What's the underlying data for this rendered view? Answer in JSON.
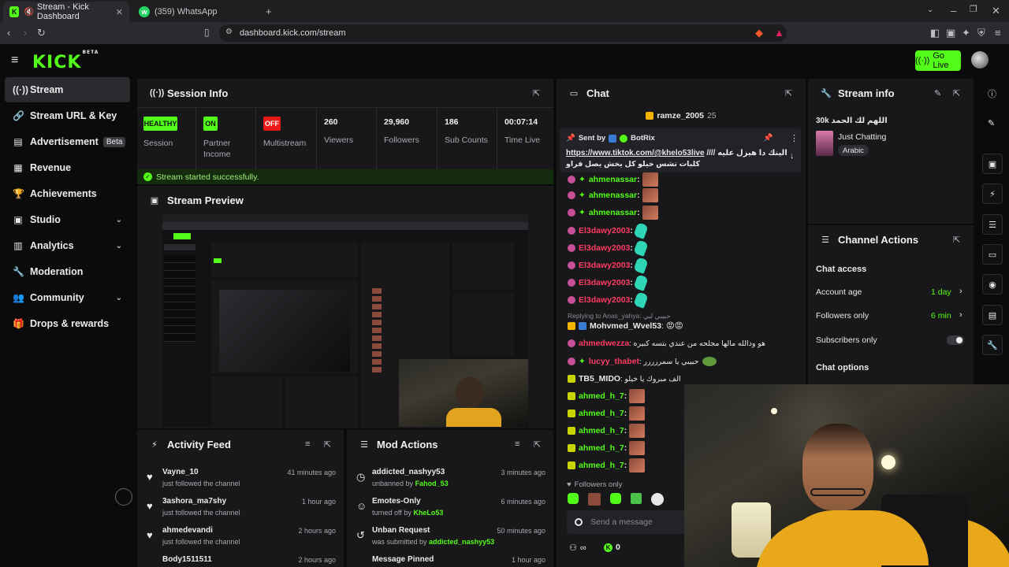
{
  "browser": {
    "tabs": [
      {
        "title": "Stream - Kick Dashboard",
        "active": true
      },
      {
        "title": "(359) WhatsApp",
        "active": false
      }
    ],
    "url": "dashboard.kick.com/stream"
  },
  "header": {
    "logo": "KICK",
    "logo_badge": "BETA",
    "go_live": "Go Live"
  },
  "sidebar": {
    "items": [
      {
        "label": "Stream",
        "icon": "broadcast-icon",
        "active": true
      },
      {
        "label": "Stream URL & Key",
        "icon": "link-icon"
      },
      {
        "label": "Advertisement",
        "icon": "ad-icon",
        "badge": "Beta"
      },
      {
        "label": "Revenue",
        "icon": "chart-icon"
      },
      {
        "label": "Achievements",
        "icon": "trophy-icon"
      },
      {
        "label": "Studio",
        "icon": "layout-icon",
        "expandable": true
      },
      {
        "label": "Analytics",
        "icon": "bar-chart-icon",
        "expandable": true
      },
      {
        "label": "Moderation",
        "icon": "wrench-icon"
      },
      {
        "label": "Community",
        "icon": "users-icon",
        "expandable": true
      },
      {
        "label": "Drops & rewards",
        "icon": "gift-icon"
      }
    ]
  },
  "session": {
    "title": "Session Info",
    "stats": [
      {
        "badge": "HEALTHY",
        "label": "Session"
      },
      {
        "badge": "ON",
        "label": "Partner\nIncome"
      },
      {
        "badge": "OFF",
        "label": "Multistream"
      },
      {
        "value": "260",
        "label": "Viewers"
      },
      {
        "value": "29,960",
        "label": "Followers"
      },
      {
        "value": "186",
        "label": "Sub Counts"
      },
      {
        "value": "00:07:14",
        "label": "Time Live"
      }
    ],
    "status": "Stream started successfully."
  },
  "preview": {
    "title": "Stream Preview"
  },
  "activity": {
    "title": "Activity Feed",
    "items": [
      {
        "name": "Vayne_10",
        "sub": "just followed the channel",
        "time": "41 minutes ago"
      },
      {
        "name": "3ashora_ma7shy",
        "sub": "just followed the channel",
        "time": "1 hour ago"
      },
      {
        "name": "ahmedevandi",
        "sub": "just followed the channel",
        "time": "2 hours ago"
      },
      {
        "name": "Body1511511",
        "sub": "",
        "time": "2 hours ago"
      }
    ]
  },
  "mod_actions": {
    "title": "Mod Actions",
    "items": [
      {
        "name": "addicted_nashyy53",
        "sub": "unbanned by",
        "by": "Fahod_53",
        "time": "3 minutes ago",
        "icon": "clock-icon"
      },
      {
        "name": "Emotes-Only",
        "sub": "turned off by",
        "by": "KheLo53",
        "time": "6 minutes ago",
        "icon": "smile-icon"
      },
      {
        "name": "Unban Request",
        "sub": "was submitted by",
        "by": "addicted_nashyy53",
        "time": "50 minutes ago",
        "icon": "history-icon"
      },
      {
        "name": "Message Pinned",
        "sub": "",
        "by": "",
        "time": "1 hour ago",
        "icon": "pin-icon"
      }
    ]
  },
  "chat": {
    "title": "Chat",
    "top_user": "ramze_2005",
    "top_count": "25",
    "pinned": {
      "sent_by_label": "Sent by",
      "sender": "BotRix",
      "link": "https://www.tiktok.com/@khelo53live",
      "text_ar": "//// الينك دا هيزل عليه",
      "text_ar2": "كلبات تشس خيلو كل يخش يصل فراو"
    },
    "messages": [
      {
        "user": "ahmenassar",
        "color": "#53fc18",
        "text": ":",
        "emote": "brown"
      },
      {
        "user": "ahmenassar",
        "color": "#53fc18",
        "text": ":",
        "emote": "brown"
      },
      {
        "user": "ahmenassar",
        "color": "#53fc18",
        "text": ":",
        "emote": "brown"
      },
      {
        "user": "El3dawy2003",
        "color": "#ff3b63",
        "text": ":",
        "emote": "teal"
      },
      {
        "user": "El3dawy2003",
        "color": "#ff3b63",
        "text": ":",
        "emote": "teal"
      },
      {
        "user": "El3dawy2003",
        "color": "#ff3b63",
        "text": ":",
        "emote": "teal"
      },
      {
        "user": "El3dawy2003",
        "color": "#ff3b63",
        "text": ":",
        "emote": "teal"
      },
      {
        "user": "El3dawy2003",
        "color": "#ff3b63",
        "text": ":",
        "emote": "teal"
      }
    ],
    "reply_note": "Replying to Anas_yahya: حبيبي لبي",
    "messages2": [
      {
        "user": "Mohvmed_Wvel53",
        "color": "#e8e8ea",
        "text": ": 😡😡"
      },
      {
        "user": "ahmedwezza",
        "color": "#ff3b63",
        "text": ": هو ودالله مالها مجلحه من عندي بتسه كبيره"
      },
      {
        "user": "lucyy_thabet",
        "color": "#ff3b63",
        "text": ": حبيبي يا سمررررر"
      },
      {
        "user": "TB5_MIDO",
        "color": "#e8e8ea",
        "text": ": الف مبروك يا خيلو"
      }
    ],
    "messages3": [
      {
        "user": "ahmed_h_7",
        "color": "#53fc18",
        "text": ":"
      },
      {
        "user": "ahmed_h_7",
        "color": "#53fc18",
        "text": ":"
      },
      {
        "user": "ahmed_h_7",
        "color": "#53fc18",
        "text": ":"
      },
      {
        "user": "ahmed_h_7",
        "color": "#53fc18",
        "text": ":"
      },
      {
        "user": "ahmed_h_7",
        "color": "#53fc18",
        "text": ":"
      }
    ],
    "followers_only": "Followers only",
    "input_placeholder": "Send a message",
    "points": "0"
  },
  "stream_info": {
    "title": "Stream info",
    "stream_title": "30k اللهم لك الحمد",
    "category": "Just Chatting",
    "tag": "Arabic"
  },
  "channel_actions": {
    "title": "Channel Actions",
    "chat_access": "Chat access",
    "rows": [
      {
        "label": "Account age",
        "value": "1 day"
      },
      {
        "label": "Followers only",
        "value": "6 min"
      },
      {
        "label": "Subscribers only",
        "value": ""
      }
    ],
    "chat_options": "Chat options"
  },
  "colors": {
    "accent": "#53fc18",
    "panel": "#18181b",
    "bg": "#0b0b0c"
  }
}
